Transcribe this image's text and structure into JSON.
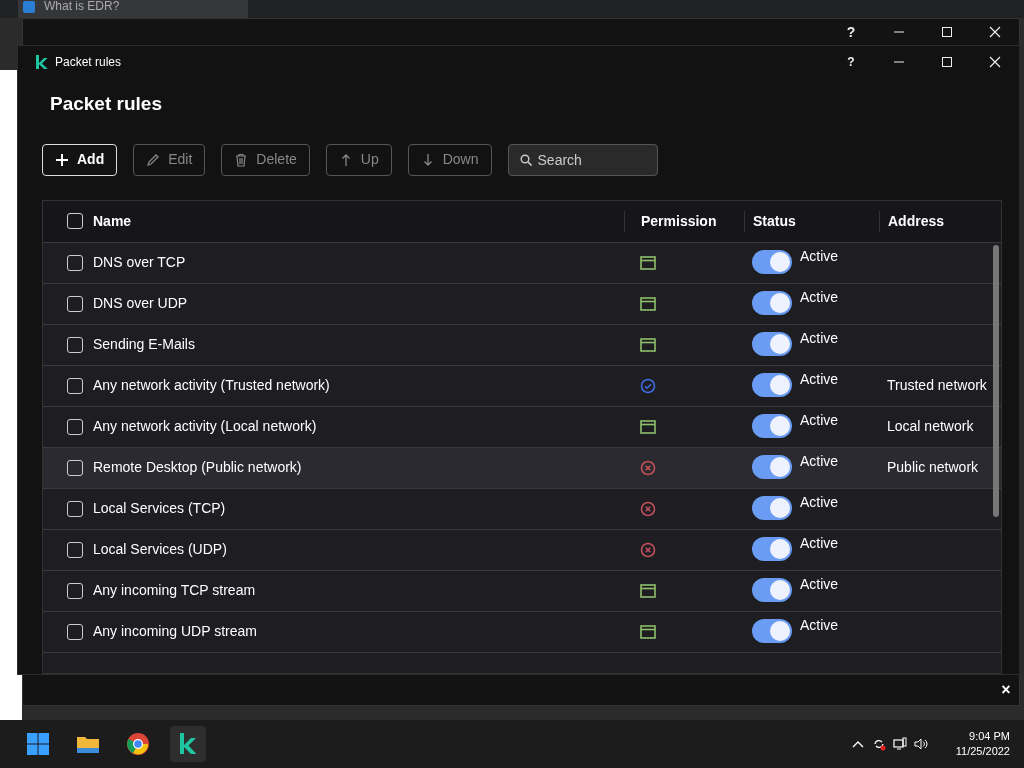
{
  "browser": {
    "tab_title": "What is EDR?"
  },
  "back_window": {
    "help": "?",
    "close_bar": "×"
  },
  "window": {
    "title": "Packet rules",
    "help": "?"
  },
  "heading": "Packet rules",
  "toolbar": [
    {
      "label": "Add",
      "disabled": false
    },
    {
      "label": "Edit",
      "disabled": true
    },
    {
      "label": "Delete",
      "disabled": true
    },
    {
      "label": "Up",
      "disabled": true
    },
    {
      "label": "Down",
      "disabled": true
    }
  ],
  "search": {
    "placeholder": "Search"
  },
  "table": {
    "select_all_checked": false,
    "columns": [
      "Name",
      "Permission",
      "Status",
      "Address"
    ],
    "rows": [
      {
        "checked": false,
        "name": "DNS over TCP",
        "permission": {
          "kind": "window"
        },
        "on": true,
        "status": "Active",
        "hovered": false
      },
      {
        "checked": false,
        "name": "DNS over UDP",
        "permission": {
          "kind": "window"
        },
        "on": true,
        "status": "Active",
        "hovered": false
      },
      {
        "checked": false,
        "name": "Sending E-Mails",
        "permission": {
          "kind": "window"
        },
        "on": true,
        "status": "Active",
        "hovered": false
      },
      {
        "checked": false,
        "name": "Any network activity (Trusted network)",
        "permission": {
          "kind": "check"
        },
        "on": true,
        "status": "Active",
        "address": "Trusted network",
        "hovered": false
      },
      {
        "checked": false,
        "name": "Any network activity (Local network)",
        "permission": {
          "kind": "window"
        },
        "on": true,
        "status": "Active",
        "address": "Local network",
        "hovered": false
      },
      {
        "checked": false,
        "name": "Remote Desktop (Public network)",
        "permission": {
          "kind": "block"
        },
        "on": true,
        "status": "Active",
        "address": "Public network",
        "hovered": true
      },
      {
        "checked": false,
        "name": "Local Services (TCP)",
        "permission": {
          "kind": "block"
        },
        "on": true,
        "status": "Active",
        "hovered": false
      },
      {
        "checked": false,
        "name": "Local Services (UDP)",
        "permission": {
          "kind": "block"
        },
        "on": true,
        "status": "Active",
        "hovered": false
      },
      {
        "checked": false,
        "name": "Any incoming TCP stream",
        "permission": {
          "kind": "window"
        },
        "on": true,
        "status": "Active",
        "hovered": false
      },
      {
        "checked": false,
        "name": "Any incoming UDP stream",
        "permission": {
          "kind": "window"
        },
        "on": true,
        "status": "Active",
        "hovered": false
      }
    ]
  },
  "taskbar": {
    "time": "9:04 PM",
    "date": "11/25/2022"
  }
}
